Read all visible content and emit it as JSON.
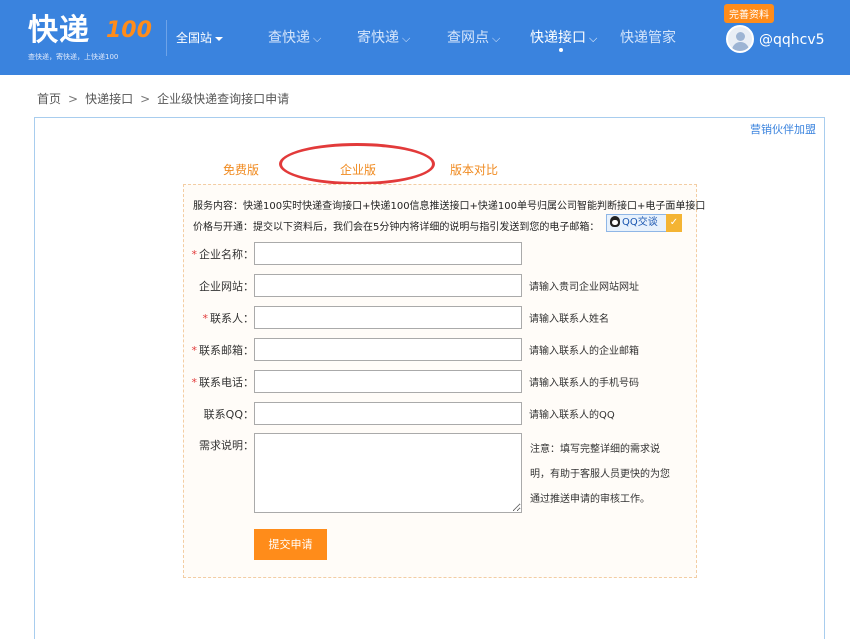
{
  "header": {
    "logo_text": "快递",
    "logo_100": "100",
    "slogan": "查快递，寄快递，上快递100",
    "region": "全国站",
    "nav": [
      {
        "label": "查快递"
      },
      {
        "label": "寄快递"
      },
      {
        "label": "查网点"
      },
      {
        "label": "快递接口"
      },
      {
        "label": "快递管家"
      }
    ],
    "badge": "完善资料",
    "username": "@qqhcv5"
  },
  "breadcrumb": [
    "首页",
    "快递接口",
    "企业级快递查询接口申请"
  ],
  "main": {
    "partner_link": "营销伙伴加盟",
    "tabs": [
      {
        "label": "免费版"
      },
      {
        "label": "企业版"
      },
      {
        "label": "版本对比"
      }
    ],
    "service_content": "服务内容：快递100实时快递查询接口+快递100信息推送接口+快递100单号归属公司智能判断接口+电子面单接口",
    "price_text": "价格与开通：提交以下资料后，我们会在5分钟内将详细的说明与指引发送到您的电子邮箱：",
    "qq_label": "QQ交谈",
    "qq_check": "✓",
    "fields": [
      {
        "label": "企业名称：",
        "required": "*",
        "value": "",
        "hint": ""
      },
      {
        "label": "企业网站：",
        "required": "",
        "value": "",
        "hint": "请输入贵司企业网站网址"
      },
      {
        "label": "联系人：",
        "required": "*",
        "value": "",
        "hint": "请输入联系人姓名"
      },
      {
        "label": "联系邮箱：",
        "required": "*",
        "value": "",
        "hint": "请输入联系人的企业邮箱"
      },
      {
        "label": "联系电话：",
        "required": "*",
        "value": "",
        "hint": "请输入联系人的手机号码"
      },
      {
        "label": "联系QQ：",
        "required": "",
        "value": "",
        "hint": "请输入联系人的QQ"
      }
    ],
    "requirement_label": "需求说明：",
    "note": "注意：填写完整详细的需求说明，有助于客服人员更快的为您通过推送申请的审核工作。",
    "submit": "提交申请"
  },
  "colors": {
    "header_bg": "#3a83de",
    "accent": "#ff8c1a",
    "tab_text": "#f08a1f",
    "circle": "#e23a3a"
  }
}
